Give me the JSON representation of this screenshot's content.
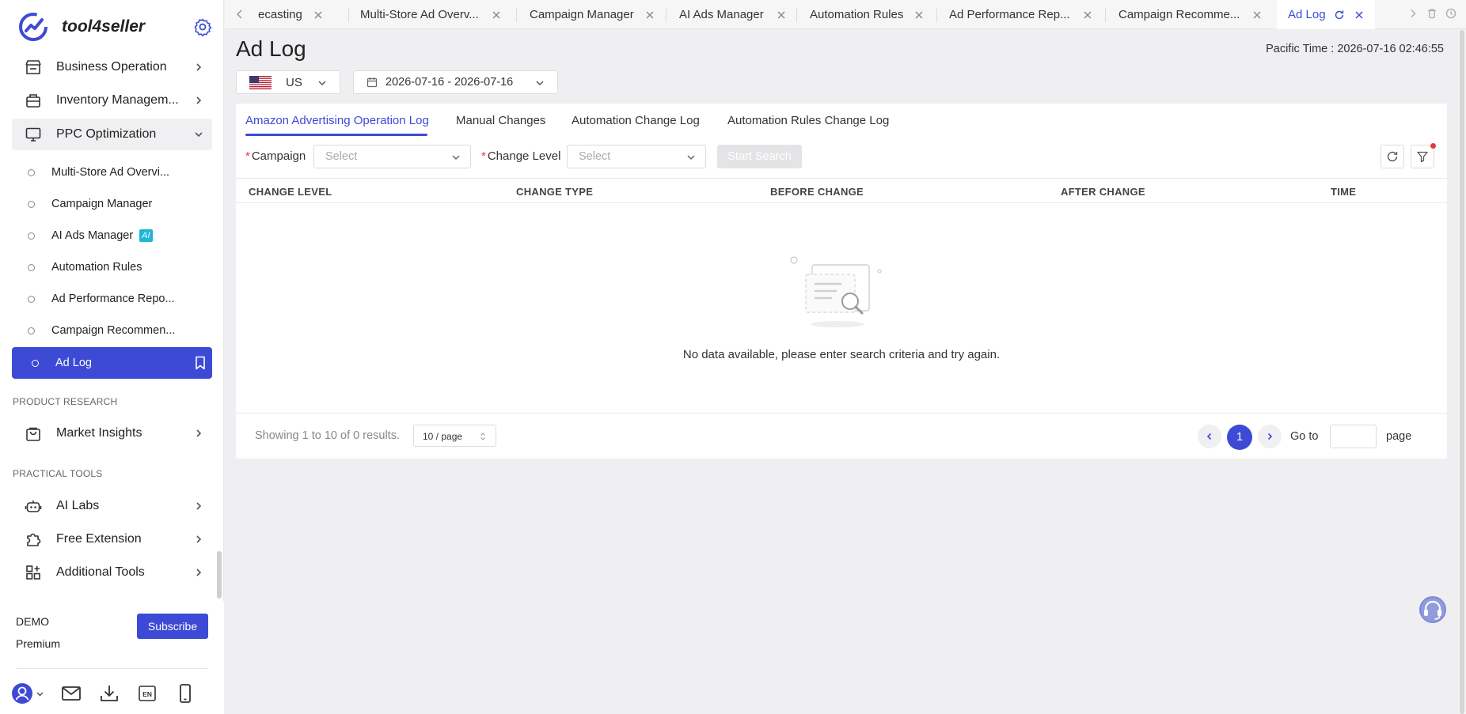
{
  "brand": {
    "name": "tool4seller"
  },
  "sidebar": {
    "top_items": [
      {
        "label": "Business Operation",
        "icon": "store-icon"
      },
      {
        "label": "Inventory Managem...",
        "icon": "inventory-box-icon"
      },
      {
        "label": "PPC Optimization",
        "icon": "monitor-icon",
        "expanded": true
      }
    ],
    "ppc_sub_items": [
      {
        "label": "Multi-Store Ad Overvi..."
      },
      {
        "label": "Campaign Manager"
      },
      {
        "label": "AI Ads Manager",
        "badge": "AI"
      },
      {
        "label": "Automation Rules"
      },
      {
        "label": "Ad Performance Repo..."
      },
      {
        "label": "Campaign Recommen..."
      },
      {
        "label": "Ad Log",
        "active": true
      }
    ],
    "section_product_research": "PRODUCT RESEARCH",
    "market_insights": "Market Insights",
    "section_practical_tools": "PRACTICAL TOOLS",
    "tools": [
      {
        "label": "AI Labs",
        "icon": "robot-icon"
      },
      {
        "label": "Free Extension",
        "icon": "puzzle-icon"
      },
      {
        "label": "Additional Tools",
        "icon": "grid-plus-icon"
      }
    ],
    "footer": {
      "plan_name": "DEMO",
      "plan_level": "Premium",
      "subscribe_label": "Subscribe",
      "lang_badge": "EN"
    }
  },
  "tabs": [
    {
      "label": "ecasting"
    },
    {
      "label": "Multi-Store Ad Overv..."
    },
    {
      "label": "Campaign Manager"
    },
    {
      "label": "AI Ads Manager"
    },
    {
      "label": "Automation Rules"
    },
    {
      "label": "Ad Performance Rep..."
    },
    {
      "label": "Campaign Recomme..."
    },
    {
      "label": "Ad Log",
      "active": true
    }
  ],
  "page": {
    "title": "Ad Log",
    "timezone_label": "Pacific Time : ",
    "timezone_value": "2026-07-16 02:46:55",
    "country": "US",
    "date_range": "2026-07-16 - 2026-07-16"
  },
  "log_tabs": [
    {
      "label": "Amazon Advertising Operation Log",
      "active": true
    },
    {
      "label": "Manual Changes"
    },
    {
      "label": "Automation Change Log"
    },
    {
      "label": "Automation Rules Change Log"
    }
  ],
  "filters": {
    "campaign_label": "Campaign",
    "campaign_placeholder": "Select",
    "change_level_label": "Change Level",
    "change_level_placeholder": "Select",
    "start_search_label": "Start Search",
    "required_mark": "*"
  },
  "table": {
    "columns": [
      "CHANGE LEVEL",
      "CHANGE TYPE",
      "BEFORE CHANGE",
      "AFTER CHANGE",
      "TIME"
    ],
    "rows": [],
    "empty_message": "No data available, please enter search criteria and try again."
  },
  "pagination": {
    "summary": "Showing 1 to 10 of 0 results.",
    "page_size": "10 / page",
    "current_page": "1",
    "goto_label": "Go to",
    "page_label": "page"
  },
  "colors": {
    "accent": "#3c4ad5",
    "required": "#e03a3a",
    "background": "#efeff1"
  }
}
